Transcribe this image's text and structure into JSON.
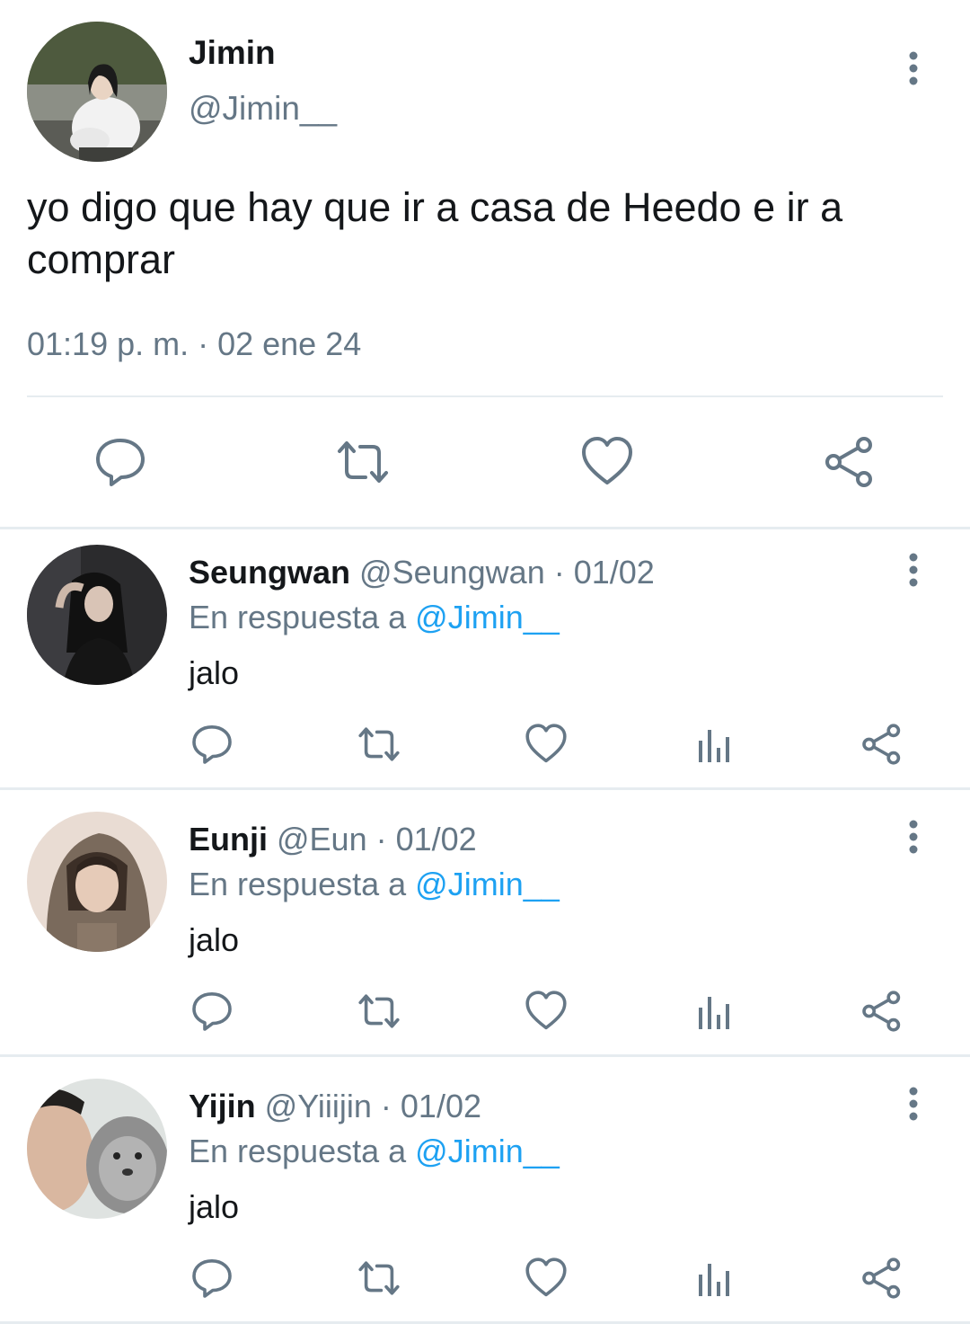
{
  "main_tweet": {
    "author_name": "Jimin",
    "author_handle": "@Jimin__",
    "text": "yo digo que hay que ir a casa de Heedo e ir a comprar",
    "timestamp": "01:19 p. m. · 02 ene 24",
    "actions": [
      "reply-icon",
      "retweet-icon",
      "like-icon",
      "share-icon"
    ]
  },
  "replies": [
    {
      "name": "Seungwan",
      "meta": " @Seungwan · 01/02",
      "in_reply_prefix": "En respuesta a ",
      "in_reply_to": "@Jimin__",
      "text": "jalo"
    },
    {
      "name": "Eunji",
      "meta": " @Eun · 01/02",
      "in_reply_prefix": "En respuesta a ",
      "in_reply_to": "@Jimin__",
      "text": "jalo"
    },
    {
      "name": "Yijin",
      "meta": " @Yiiijin · 01/02",
      "in_reply_prefix": "En respuesta a ",
      "in_reply_to": "@Jimin__",
      "text": "jalo"
    }
  ],
  "colors": {
    "text": "#14171a",
    "secondary": "#657786",
    "link": "#1da1f2",
    "divider": "#e6ecf0"
  }
}
